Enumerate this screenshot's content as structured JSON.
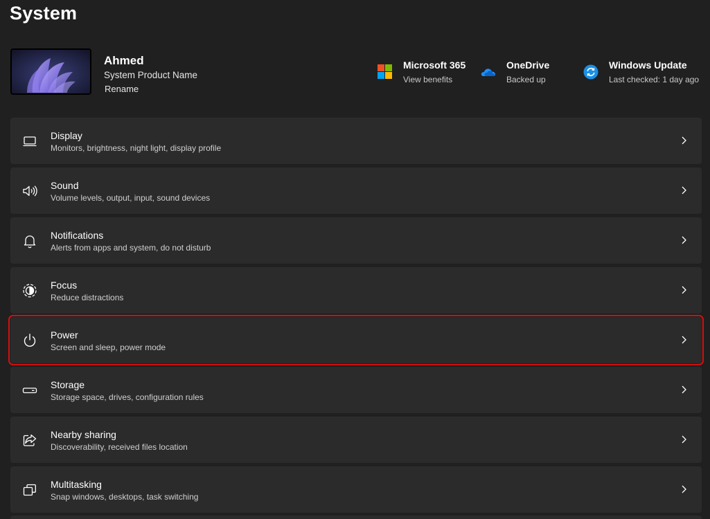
{
  "page": {
    "title": "System"
  },
  "profile": {
    "name": "Ahmed",
    "product": "System Product Name",
    "rename": "Rename"
  },
  "quick_tiles": [
    {
      "title": "Microsoft 365",
      "subtitle": "View benefits",
      "icon": "microsoft-logo-icon"
    },
    {
      "title": "OneDrive",
      "subtitle": "Backed up",
      "icon": "onedrive-cloud-icon"
    },
    {
      "title": "Windows Update",
      "subtitle": "Last checked: 1 day ago",
      "icon": "windows-update-icon"
    }
  ],
  "settings": [
    {
      "title": "Display",
      "description": "Monitors, brightness, night light, display profile",
      "icon": "display-icon"
    },
    {
      "title": "Sound",
      "description": "Volume levels, output, input, sound devices",
      "icon": "speaker-icon"
    },
    {
      "title": "Notifications",
      "description": "Alerts from apps and system, do not disturb",
      "icon": "bell-icon"
    },
    {
      "title": "Focus",
      "description": "Reduce distractions",
      "icon": "focus-icon"
    },
    {
      "title": "Power",
      "description": "Screen and sleep, power mode",
      "icon": "power-icon",
      "highlighted": true
    },
    {
      "title": "Storage",
      "description": "Storage space, drives, configuration rules",
      "icon": "storage-drive-icon"
    },
    {
      "title": "Nearby sharing",
      "description": "Discoverability, received files location",
      "icon": "share-icon"
    },
    {
      "title": "Multitasking",
      "description": "Snap windows, desktops, task switching",
      "icon": "multitasking-icon"
    }
  ],
  "colors": {
    "background": "#202020",
    "card": "#2b2b2b",
    "highlight_border": "#d40f0f",
    "accent": "#4cc2ff"
  }
}
